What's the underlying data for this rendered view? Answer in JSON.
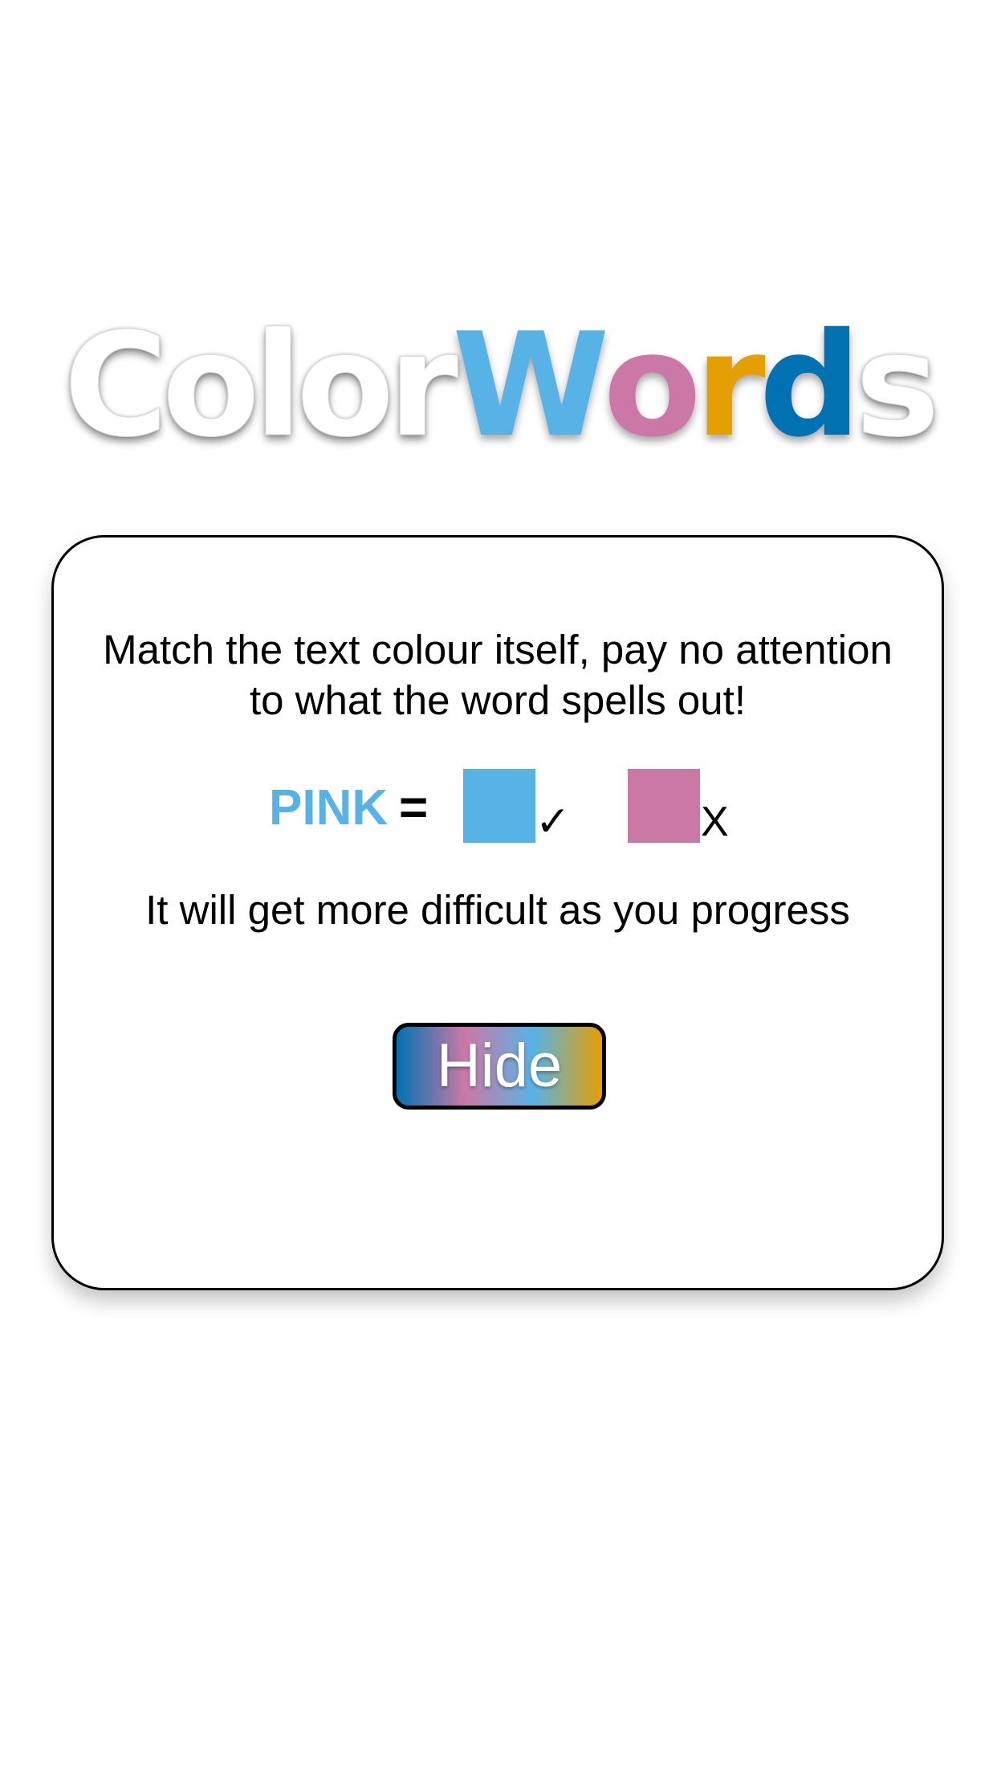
{
  "logo": {
    "letters": [
      {
        "char": "C",
        "color": "plain"
      },
      {
        "char": "o",
        "color": "plain"
      },
      {
        "char": "l",
        "color": "plain"
      },
      {
        "char": "o",
        "color": "plain"
      },
      {
        "char": "r",
        "color": "plain"
      },
      {
        "char": "W",
        "color": "#57b3e6"
      },
      {
        "char": "o",
        "color": "#cc78a6"
      },
      {
        "char": "r",
        "color": "#e69f00"
      },
      {
        "char": "d",
        "color": "#0072b2"
      },
      {
        "char": "s",
        "color": "plain"
      }
    ]
  },
  "card": {
    "instruction": "Match the text colour itself, pay no attention to what the word spells out!",
    "example": {
      "word": "PINK",
      "word_color": "#57b3e6",
      "equals": "=",
      "correct_swatch_color": "#57b3e6",
      "correct_mark": "✓",
      "wrong_swatch_color": "#cc78a6",
      "wrong_mark": "X"
    },
    "difficulty_note": "It will get more difficult as you progress",
    "hide_button": {
      "label": "Hide",
      "gradient": [
        "#0072b2",
        "#cc78a6",
        "#57b3e6",
        "#e69f00"
      ]
    }
  }
}
